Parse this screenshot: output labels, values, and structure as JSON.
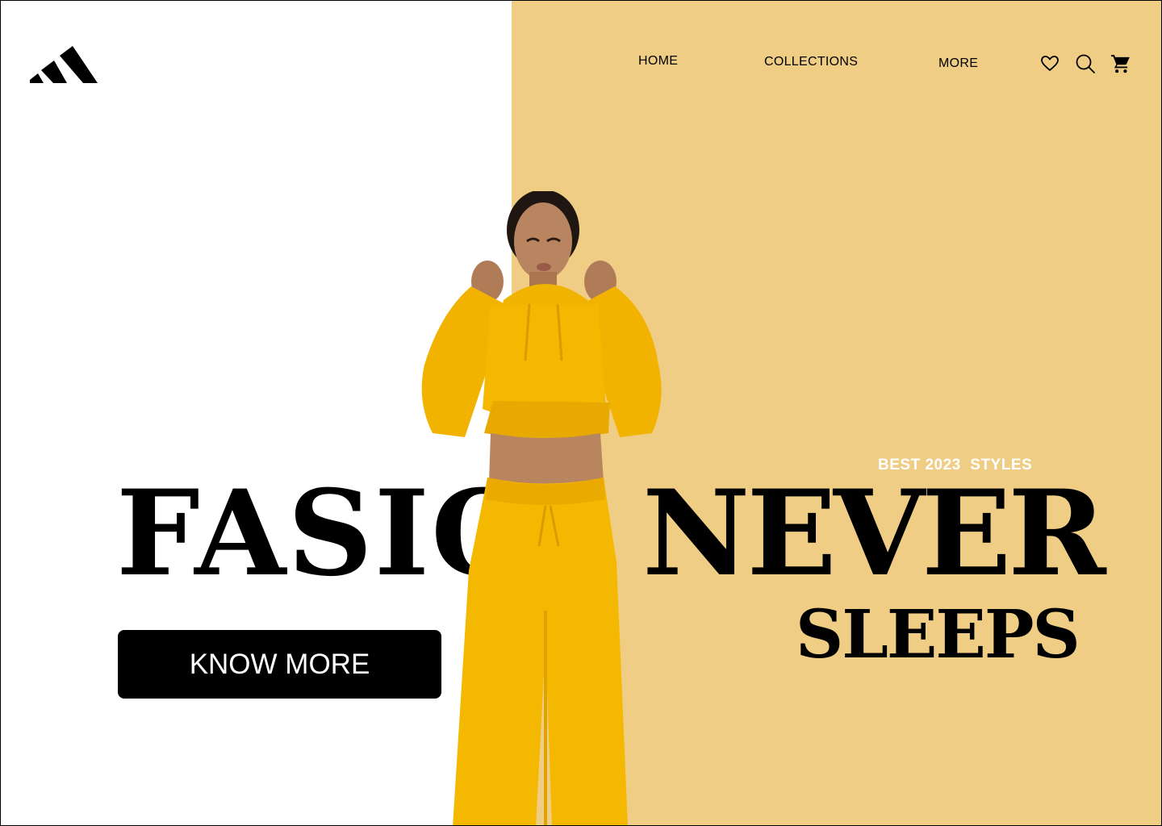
{
  "brand": {
    "logo_icon": "three-stripes-logo-icon"
  },
  "nav": {
    "links": [
      {
        "label": "HOME"
      },
      {
        "label": "COLLECTIONS"
      },
      {
        "label": "MORE"
      }
    ],
    "icons": [
      "heart-icon",
      "search-icon",
      "cart-icon"
    ]
  },
  "hero": {
    "eyebrow": "BEST 2023  STYLES",
    "headline_left": "FASIO",
    "headline_right": "NEVER",
    "headline_second": "SLEEPS",
    "cta_label": "KNOW MORE",
    "image": "model-in-yellow-tracksuit"
  },
  "colors": {
    "panel": "#efcd85",
    "background": "#ffffff",
    "ink": "#000000",
    "outfit": "#f5b800"
  }
}
